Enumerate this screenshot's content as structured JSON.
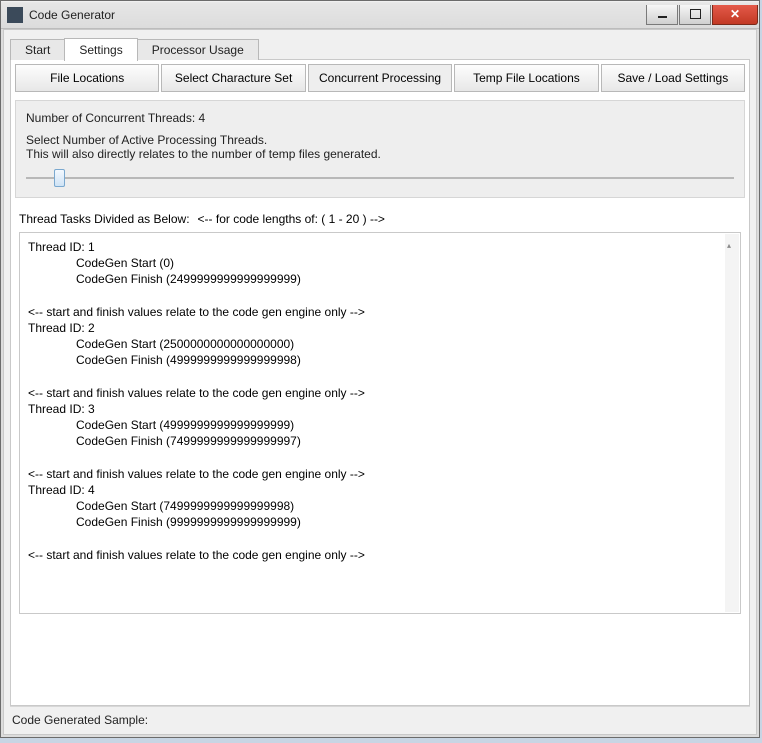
{
  "window": {
    "title": "Code Generator"
  },
  "main_tabs": {
    "items": [
      {
        "label": "Start",
        "active": false
      },
      {
        "label": "Settings",
        "active": true
      },
      {
        "label": "Processor Usage",
        "active": false
      }
    ]
  },
  "sub_tabs": {
    "items": [
      {
        "label": "File Locations",
        "active": false
      },
      {
        "label": "Select Characture Set",
        "active": false
      },
      {
        "label": "Concurrent Processing",
        "active": true
      },
      {
        "label": "Temp File Locations",
        "active": false
      },
      {
        "label": "Save / Load Settings",
        "active": false
      }
    ]
  },
  "panel": {
    "heading": "Number of Concurrent Threads: 4",
    "line1": "Select Number of Active Processing Threads.",
    "line2": "This will also directly relates to the number of temp files generated."
  },
  "tasks_label": "Thread Tasks Divided as Below:",
  "tasks_suffix": "<-- for code lengths of: ( 1 - 20 ) -->",
  "threads_note": "<-- start and finish values relate to the code gen engine only -->",
  "threads": [
    {
      "id": 1,
      "start": "0",
      "finish": "2499999999999999999"
    },
    {
      "id": 2,
      "start": "2500000000000000000",
      "finish": "4999999999999999998"
    },
    {
      "id": 3,
      "start": "4999999999999999999",
      "finish": "7499999999999999997"
    },
    {
      "id": 4,
      "start": "7499999999999999998",
      "finish": "9999999999999999999"
    }
  ],
  "status": "Code Generated Sample:"
}
